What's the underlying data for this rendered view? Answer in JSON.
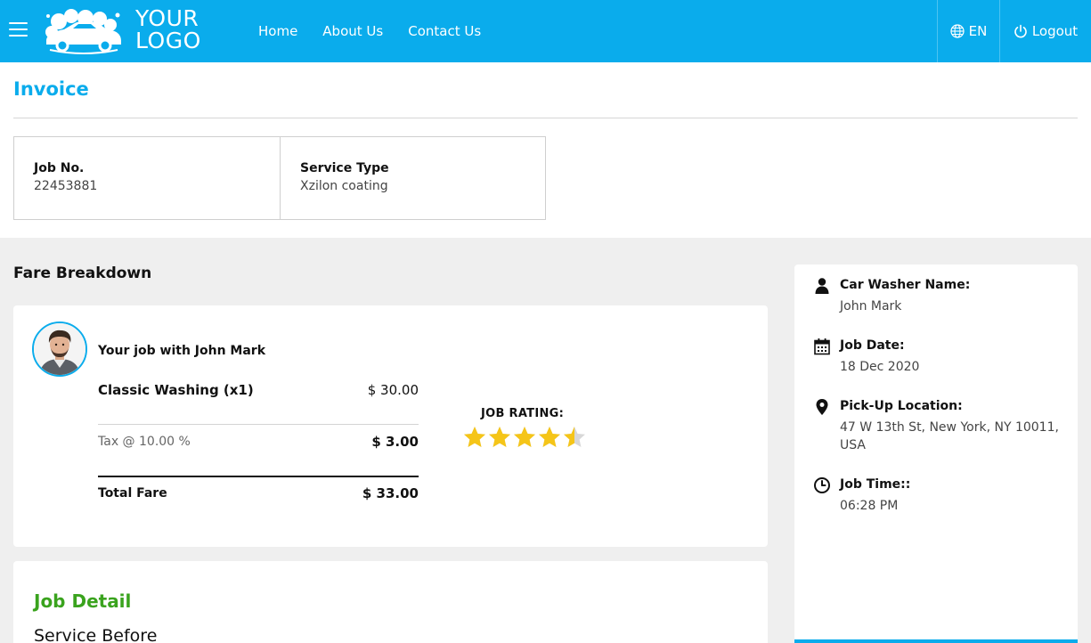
{
  "header": {
    "logo_line1": "YOUR",
    "logo_line2": "LOGO",
    "nav": [
      "Home",
      "About Us",
      "Contact Us"
    ],
    "language": "EN",
    "logout": "Logout"
  },
  "invoice": {
    "title": "Invoice",
    "job_no_label": "Job No.",
    "job_no": "22453881",
    "service_type_label": "Service Type",
    "service_type": "Xzilon coating"
  },
  "fare": {
    "heading": "Fare Breakdown",
    "job_with": "Your job with John Mark",
    "item_label": "Classic Washing (x1)",
    "item_amount": "$ 30.00",
    "tax_label": "Tax @ 10.00 %",
    "tax_amount": "$ 3.00",
    "total_label": "Total Fare",
    "total_amount": "$ 33.00",
    "rating_label": "JOB RATING:",
    "rating": 4.5,
    "rating_max": 5
  },
  "job_detail": {
    "title": "Job Detail",
    "service_before": "Service Before"
  },
  "sidebar": {
    "washer_label": "Car Washer Name:",
    "washer_name": "John Mark",
    "date_label": "Job Date:",
    "date": "18 Dec 2020",
    "location_label": "Pick-Up Location:",
    "location": "47 W 13th St, New York, NY 10011, USA",
    "time_label": "Job Time::",
    "time": "06:28 PM"
  },
  "colors": {
    "brand": "#0aacec",
    "detail_title": "#3aa31e",
    "star": "#f5c518"
  }
}
